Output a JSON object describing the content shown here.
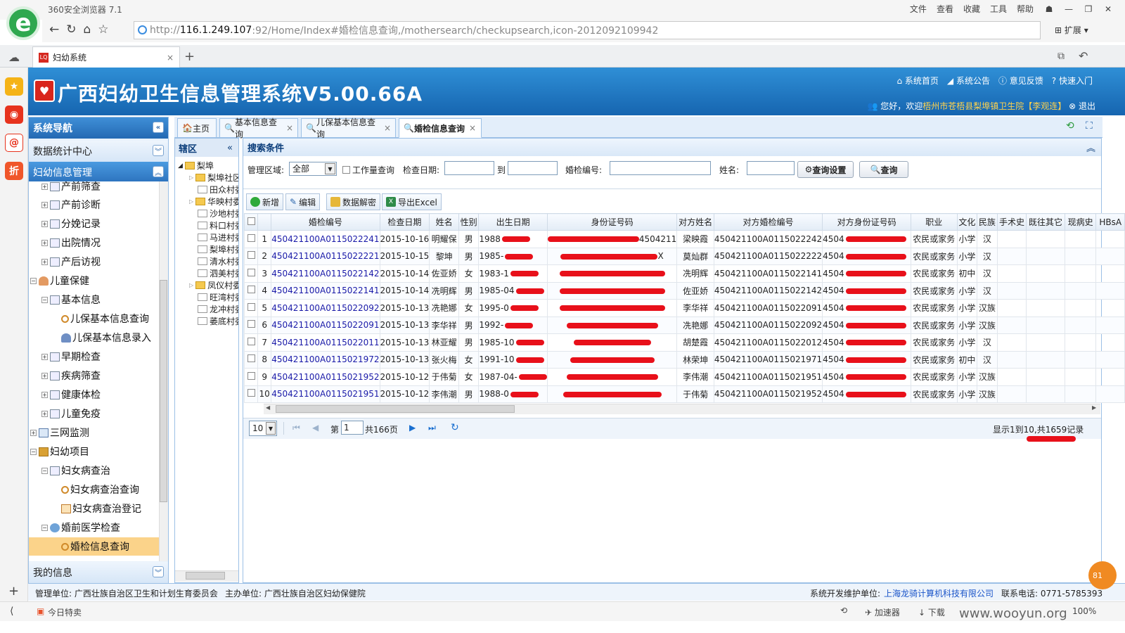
{
  "browser": {
    "name": "360安全浏览器 7.1",
    "menus": [
      "文件",
      "查看",
      "收藏",
      "工具",
      "帮助"
    ],
    "url_prefix": "http://",
    "url_host": "116.1.249.107",
    "url_rest": ":92/Home/Index#婚检信息查询,/mothersearch/checkupsearch,icon-2012092109942",
    "ext_label": "扩展",
    "tab_title": "妇幼系统",
    "logo_letter": "e"
  },
  "app": {
    "title": "广西妇幼卫生信息管理系统V5.00.66A",
    "links": [
      "系统首页",
      "系统公告",
      "意见反馈",
      "快速入门"
    ],
    "welcome_prefix": "您好，欢迎",
    "welcome_org": "梧州市苍梧县梨埠镇卫生院",
    "welcome_user": "【李观连】",
    "logout": "退出"
  },
  "nav": {
    "header": "系统导航",
    "stats": "数据统计中心",
    "section": "妇幼信息管理",
    "my": "我的信息",
    "items": [
      "产前筛查",
      "产前诊断",
      "分娩记录",
      "出院情况",
      "产后访视",
      "儿童保健",
      "基本信息",
      "儿保基本信息查询",
      "儿保基本信息录入",
      "早期检查",
      "疾病筛查",
      "健康体检",
      "儿童免疫",
      "三网监测",
      "妇幼项目",
      "妇女病查治",
      "妇女病查治查询",
      "妇女病查治登记",
      "婚前医学检查",
      "婚检信息查询"
    ]
  },
  "region": {
    "header": "辖区",
    "root": "梨埠",
    "items": [
      "梨埠社区",
      "田众村委",
      "华映村委",
      "沙地村委",
      "料口村委",
      "马进村委",
      "梨埠村委",
      "清水村委",
      "泗美村委",
      "凤仪村委",
      "旺湾村委",
      "龙冲村委",
      "萎底村委"
    ]
  },
  "tabs": [
    "主页",
    "基本信息查询",
    "儿保基本信息查询",
    "婚检信息查询"
  ],
  "search": {
    "header": "搜索条件",
    "area_label": "管理区域:",
    "area_value": "全部",
    "workload": "工作量查询",
    "date_label": "检查日期:",
    "to": "到",
    "code_label": "婚检编号:",
    "name_label": "姓名:",
    "settings_btn": "查询设置",
    "query_btn": "查询"
  },
  "toolbar": [
    "新增",
    "编辑",
    "数据解密",
    "导出Excel"
  ],
  "table": {
    "headers": [
      "婚检编号",
      "检查日期",
      "姓名",
      "性别",
      "出生日期",
      "身份证号码",
      "对方姓名",
      "对方婚检编号",
      "对方身份证号码",
      "职业",
      "文化",
      "民族",
      "手术史",
      "既往其它",
      "现病史",
      "HBsA"
    ],
    "rows": [
      [
        "1",
        "450421100A0115022241",
        "2015-10-16",
        "明耀保",
        "男",
        "1988",
        "4504211",
        "梁映霞",
        "450421100A0115022242",
        "4504",
        "农民或家务",
        "小学",
        "汉"
      ],
      [
        "2",
        "450421100A0115022221",
        "2015-10-15",
        "黎坤",
        "男",
        "1985-",
        "X",
        "莫灿群",
        "450421100A0115022222",
        "4504",
        "农民或家务",
        "小学",
        "汉"
      ],
      [
        "3",
        "450421100A0115022142",
        "2015-10-14",
        "佐亚娇",
        "女",
        "1983-1",
        "",
        "冼明辉",
        "450421100A0115022141",
        "4504",
        "农民或家务",
        "初中",
        "汉"
      ],
      [
        "4",
        "450421100A0115022141",
        "2015-10-14",
        "冼明辉",
        "男",
        "1985-04",
        "",
        "佐亚娇",
        "450421100A0115022142",
        "4504",
        "农民或家务",
        "小学",
        "汉"
      ],
      [
        "5",
        "450421100A0115022092",
        "2015-10-13",
        "冼艳娜",
        "女",
        "1995-0",
        "",
        "李华祥",
        "450421100A0115022091",
        "4504",
        "农民或家务",
        "小学",
        "汉族"
      ],
      [
        "6",
        "450421100A0115022091",
        "2015-10-13",
        "李华祥",
        "男",
        "1992-",
        "",
        "冼艳娜",
        "450421100A0115022092",
        "4504",
        "农民或家务",
        "小学",
        "汉族"
      ],
      [
        "7",
        "450421100A0115022011",
        "2015-10-13",
        "林亚耀",
        "男",
        "1985-10",
        "",
        "胡楚霞",
        "450421100A0115022012",
        "4504",
        "农民或家务",
        "小学",
        "汉"
      ],
      [
        "8",
        "450421100A0115021972",
        "2015-10-13",
        "张火梅",
        "女",
        "1991-10",
        "",
        "林荣坤",
        "450421100A0115021971",
        "4504",
        "农民或家务",
        "初中",
        "汉"
      ],
      [
        "9",
        "450421100A0115021952",
        "2015-10-12",
        "于伟菊",
        "女",
        "1987-04-",
        "",
        "李伟潮",
        "450421100A0115021951",
        "4504",
        "农民或家务",
        "小学",
        "汉族"
      ],
      [
        "10",
        "450421100A0115021951",
        "2015-10-12",
        "李伟潮",
        "男",
        "1988-0",
        "",
        "于伟菊",
        "450421100A0115021952",
        "4504",
        "农民或家务",
        "小学",
        "汉族"
      ]
    ]
  },
  "pager": {
    "size": "10",
    "page_prefix": "第",
    "page_value": "1",
    "page_total": "共166页",
    "summary": "显示1到10,共1659记录"
  },
  "footer": {
    "manage": "管理单位: 广西壮族自治区卫生和计划生育委员会",
    "host": "主办单位: 广西壮族自治区妇幼保健院",
    "dev_label": "系统开发维护单位: ",
    "dev": "上海龙骑计算机科技有限公司",
    "phone": "联系电话: 0771-5785393"
  },
  "statusbar": {
    "deal": "今日特卖",
    "accel": "加速器",
    "download": "下载",
    "zoom": "100%",
    "watermark": "www.wooyun.org"
  }
}
